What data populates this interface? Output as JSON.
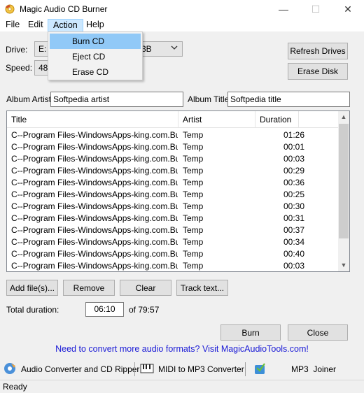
{
  "window": {
    "title": "Magic Audio CD Burner",
    "minimize_glyph": "—",
    "maximize_glyph": "☐",
    "close_glyph": "✕",
    "icon": "cd-burner-icon"
  },
  "menu": {
    "items": [
      "File",
      "Edit",
      "Action",
      "Help"
    ],
    "active": "Action"
  },
  "action_menu": {
    "items": [
      "Burn CD",
      "Eject CD",
      "Erase CD"
    ],
    "highlighted": "Burn CD"
  },
  "drive": {
    "label": "Drive:",
    "value": "E:",
    "value_suffix": "3B"
  },
  "speed": {
    "label": "Speed:",
    "value": "48."
  },
  "buttons": {
    "refresh_drives": "Refresh Drives",
    "erase_disk": "Erase Disk",
    "add_files": "Add file(s)...",
    "remove": "Remove",
    "clear": "Clear",
    "track_text": "Track text...",
    "burn": "Burn",
    "close": "Close"
  },
  "album_artist": {
    "label": "Album Artist:",
    "value": "Softpedia artist"
  },
  "album_title": {
    "label": "Album Title:",
    "value": "Softpedia title"
  },
  "tracklist": {
    "columns": [
      "Title",
      "Artist",
      "Duration"
    ],
    "rows": [
      {
        "title": "C--Program Files-WindowsApps-king.com.Bub...",
        "artist": "Temp",
        "duration": "01:26"
      },
      {
        "title": "C--Program Files-WindowsApps-king.com.Bub...",
        "artist": "Temp",
        "duration": "00:01"
      },
      {
        "title": "C--Program Files-WindowsApps-king.com.Bub...",
        "artist": "Temp",
        "duration": "00:03"
      },
      {
        "title": "C--Program Files-WindowsApps-king.com.Bub...",
        "artist": "Temp",
        "duration": "00:29"
      },
      {
        "title": "C--Program Files-WindowsApps-king.com.Bub...",
        "artist": "Temp",
        "duration": "00:36"
      },
      {
        "title": "C--Program Files-WindowsApps-king.com.Bub...",
        "artist": "Temp",
        "duration": "00:25"
      },
      {
        "title": "C--Program Files-WindowsApps-king.com.Bub...",
        "artist": "Temp",
        "duration": "00:30"
      },
      {
        "title": "C--Program Files-WindowsApps-king.com.Bub...",
        "artist": "Temp",
        "duration": "00:31"
      },
      {
        "title": "C--Program Files-WindowsApps-king.com.Bub...",
        "artist": "Temp",
        "duration": "00:37"
      },
      {
        "title": "C--Program Files-WindowsApps-king.com.Bub...",
        "artist": "Temp",
        "duration": "00:34"
      },
      {
        "title": "C--Program Files-WindowsApps-king.com.Bub...",
        "artist": "Temp",
        "duration": "00:40"
      },
      {
        "title": "C--Program Files-WindowsApps-king.com.Bub...",
        "artist": "Temp",
        "duration": "00:03"
      }
    ],
    "scroll_up_glyph": "▲",
    "scroll_down_glyph": "▼"
  },
  "total": {
    "label": "Total duration:",
    "value": "06:10",
    "of_text": "of 79:57"
  },
  "promo_text": "Need to convert more audio formats? Visit MagicAudioTools.com!",
  "tools": [
    {
      "label": "Audio Converter and CD Ripper",
      "icon": "audio-converter-icon"
    },
    {
      "label": "MIDI to MP3 Converter",
      "icon": "midi-icon"
    },
    {
      "label": "MP3  Joiner",
      "icon": "mp3-joiner-icon"
    }
  ],
  "status": "Ready",
  "colors": {
    "accent_menu": "#cce8ff",
    "highlight": "#91c9f7",
    "link": "#1a1ad6"
  }
}
